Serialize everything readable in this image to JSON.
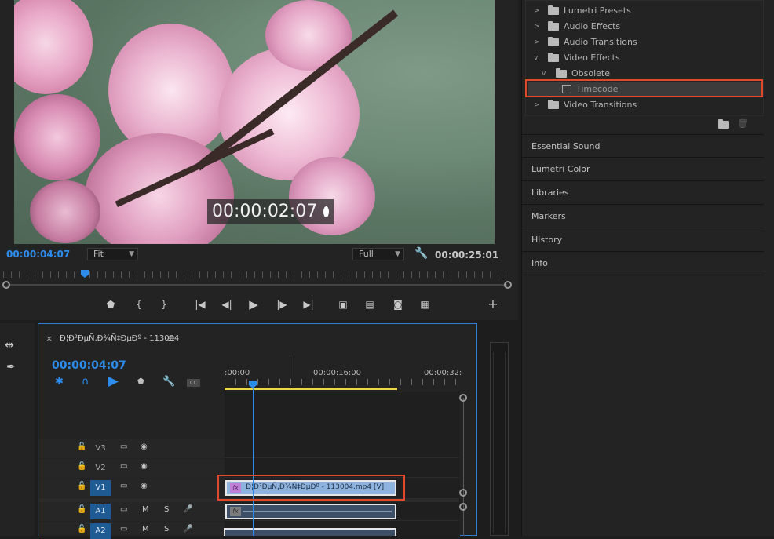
{
  "monitor": {
    "timecode_overlay": "00:00:02:07",
    "current_time": "00:00:04:07",
    "zoom": "Fit",
    "quality": "Full",
    "duration": "00:00:25:01",
    "playhead_fraction": 0.16,
    "icons": [
      "marker-icon",
      "mark-in-icon",
      "mark-out-icon",
      "go-to-in-icon",
      "step-back-icon",
      "play-icon",
      "step-forward-icon",
      "go-to-out-icon",
      "lift-icon",
      "extract-icon",
      "export-frame-icon",
      "comparison-view-icon",
      "add-button-icon",
      "wrench-icon"
    ]
  },
  "effects": {
    "items": [
      {
        "label": "Lumetri Presets",
        "indent": 0,
        "expanded": false
      },
      {
        "label": "Audio Effects",
        "indent": 0,
        "expanded": false
      },
      {
        "label": "Audio Transitions",
        "indent": 0,
        "expanded": false
      },
      {
        "label": "Video Effects",
        "indent": 0,
        "expanded": true
      },
      {
        "label": "Obsolete",
        "indent": 1,
        "expanded": true
      },
      {
        "label": "Timecode",
        "indent": 2,
        "selected": true
      },
      {
        "label": "Video Transitions",
        "indent": 0,
        "expanded": false
      }
    ]
  },
  "panels": {
    "tabs": [
      "Essential Sound",
      "Lumetri Color",
      "Libraries",
      "Markers",
      "History",
      "Info"
    ]
  },
  "timeline": {
    "sequence_name": "Ð¦Ð²ÐµÑ‚Ð¾Ñ‡ÐµÐº - 113004",
    "current_time": "00:00:04:07",
    "ruler_labels": [
      ":00:00",
      "00:00:16:00",
      "00:00:32:"
    ],
    "clip_label": "Ð¦Ð²ÐµÑ‚Ð¾Ñ‡ÐµÐº - 113004.mp4 [V]",
    "tracks": [
      {
        "name": "V3",
        "targeted": false
      },
      {
        "name": "V2",
        "targeted": false
      },
      {
        "name": "V1",
        "targeted": true
      },
      {
        "name": "A1",
        "targeted": true
      },
      {
        "name": "A2",
        "targeted": true
      }
    ],
    "audio_buttons": {
      "mute": "M",
      "solo": "S"
    },
    "cc_label": "CC"
  }
}
